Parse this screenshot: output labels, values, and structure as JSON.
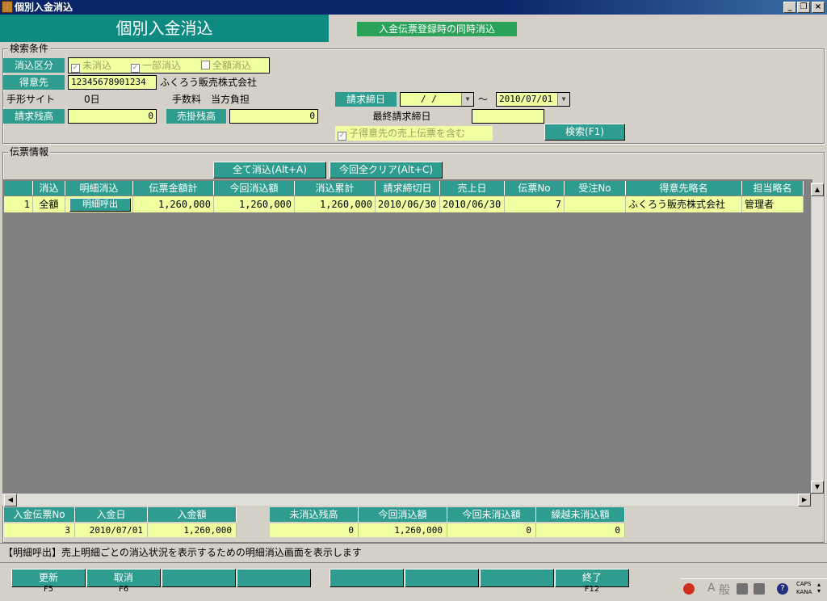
{
  "window": {
    "title": "個別入金消込"
  },
  "header": {
    "title": "個別入金消込",
    "sync_label": "入金伝票登録時の同時消込"
  },
  "search": {
    "group_title": "検索条件",
    "category_label": "消込区分",
    "category_options": [
      "未消込",
      "一部消込",
      "全額消込"
    ],
    "customer_label": "得意先",
    "customer_code": "12345678901234",
    "customer_name": "ふくろう販売株式会社",
    "note_site_label": "手形サイト",
    "note_site_value": "0日",
    "fee_label": "手数料",
    "fee_value": "当方負担",
    "billing_balance_label": "請求残高",
    "billing_balance_value": "0",
    "ar_balance_label": "売掛残高",
    "ar_balance_value": "0",
    "close_date_label": "請求締日",
    "close_date_from": " / /",
    "tilde": "～",
    "close_date_to": "2010/07/01",
    "last_close_label": "最終請求締日",
    "last_close_value": "",
    "include_child_label": "子得意先の売上伝票を含む",
    "search_button": "検索(F1)"
  },
  "slips": {
    "group_title": "伝票情報",
    "clear_all_button": "全て消込(Alt+A)",
    "clear_current_button": "今回全クリア(Alt+C)",
    "columns": [
      "消込",
      "明細消込",
      "伝票金額計",
      "今回消込額",
      "消込累計",
      "請求締切日",
      "売上日",
      "伝票No",
      "受注No",
      "得意先略名",
      "担当略名"
    ],
    "rows": [
      {
        "no": "1",
        "kind": "全額",
        "detail_button": "明細呼出",
        "total": "1,260,000",
        "current": "1,260,000",
        "cumulative": "1,260,000",
        "close_date": "2010/06/30",
        "sales_date": "2010/06/30",
        "slip_no": "7",
        "order_no": "",
        "customer": "ふくろう販売株式会社",
        "staff": "管理者"
      }
    ]
  },
  "summary": {
    "deposit_no_label": "入金伝票No",
    "deposit_no": "3",
    "deposit_date_label": "入金日",
    "deposit_date": "2010/07/01",
    "deposit_amount_label": "入金額",
    "deposit_amount": "1,260,000",
    "unmatched_label": "未消込残高",
    "unmatched": "0",
    "current_label": "今回消込額",
    "current": "1,260,000",
    "current_unmatched_label": "今回未消込額",
    "current_unmatched": "0",
    "carryover_label": "繰越未消込額",
    "carryover": "0"
  },
  "status_message": "【明細呼出】売上明細ごとの消込状況を表示するための明細消込画面を表示します",
  "function_keys": [
    {
      "label": "更新",
      "key": "F5"
    },
    {
      "label": "取消",
      "key": "F6"
    },
    {
      "label": "",
      "key": ""
    },
    {
      "label": "",
      "key": ""
    },
    {
      "label": "",
      "key": ""
    },
    {
      "label": "",
      "key": ""
    },
    {
      "label": "",
      "key": ""
    },
    {
      "label": "終了",
      "key": "F12"
    }
  ],
  "tray": {
    "ime_a": "A",
    "ime_mode": "般",
    "caps": "CAPS",
    "kana": "KANA"
  }
}
